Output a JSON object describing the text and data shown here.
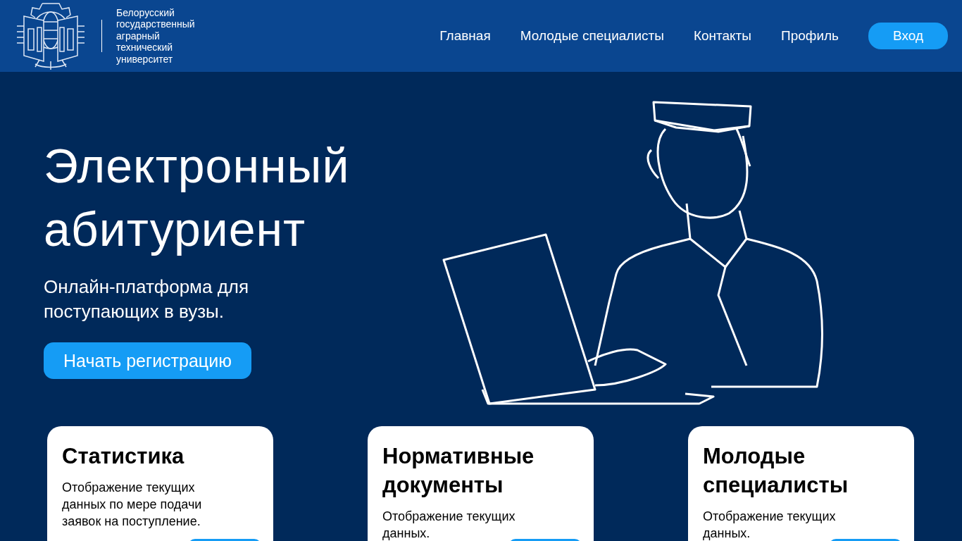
{
  "header": {
    "logo_text": [
      "Белорусский",
      "государственный",
      "аграрный",
      "технический",
      "университет"
    ],
    "nav": [
      {
        "label": "Главная"
      },
      {
        "label": "Молодые специалисты"
      },
      {
        "label": "Контакты"
      },
      {
        "label": "Профиль"
      }
    ],
    "login_button": "Вход"
  },
  "hero": {
    "title_lines": [
      "Электронный",
      "абитуриент"
    ],
    "subtitle": "Онлайн-платформа для поступающих в вузы.",
    "cta_button": "Начать регистрацию"
  },
  "cards": [
    {
      "title": "Статистика",
      "text": "Отображение текущих данных по мере подачи заявок на поступление."
    },
    {
      "title": "Нормативные документы",
      "text": "Отображение текущих данных."
    },
    {
      "title": "Молодые специалисты",
      "text": "Отображение текущих данных."
    }
  ]
}
